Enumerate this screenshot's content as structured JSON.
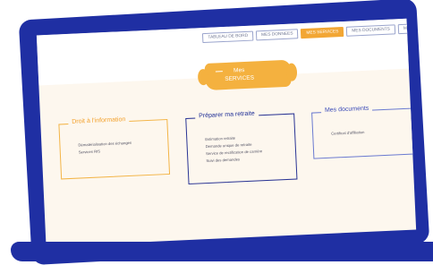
{
  "nav": {
    "tabs": [
      {
        "label": "TABLEAU DE BORD",
        "active": false
      },
      {
        "label": "MES DONNEES",
        "active": false
      },
      {
        "label": "MES SERVICES",
        "active": true
      },
      {
        "label": "MES DOCUMENTS",
        "active": false
      },
      {
        "label": "M",
        "active": false
      }
    ]
  },
  "banner": {
    "line1": "Mes",
    "line2": "SERVICES"
  },
  "cards": {
    "info": {
      "title": "Droit à l'information",
      "items": [
        "Dématérialisation des échanges",
        "Services RIS"
      ]
    },
    "retraite": {
      "title": "Préparer ma retraite",
      "items": [
        "Estimation retraite",
        "Demande unique de retraite",
        "Service de rectification de carrière",
        "Suivi des demandes"
      ]
    },
    "docs": {
      "title": "Mes documents",
      "items": [
        "Certificat d'affiliation"
      ]
    }
  },
  "colors": {
    "laptop": "#1f2fa3",
    "accent_orange": "#f2a634",
    "navy": "#2a3494"
  }
}
